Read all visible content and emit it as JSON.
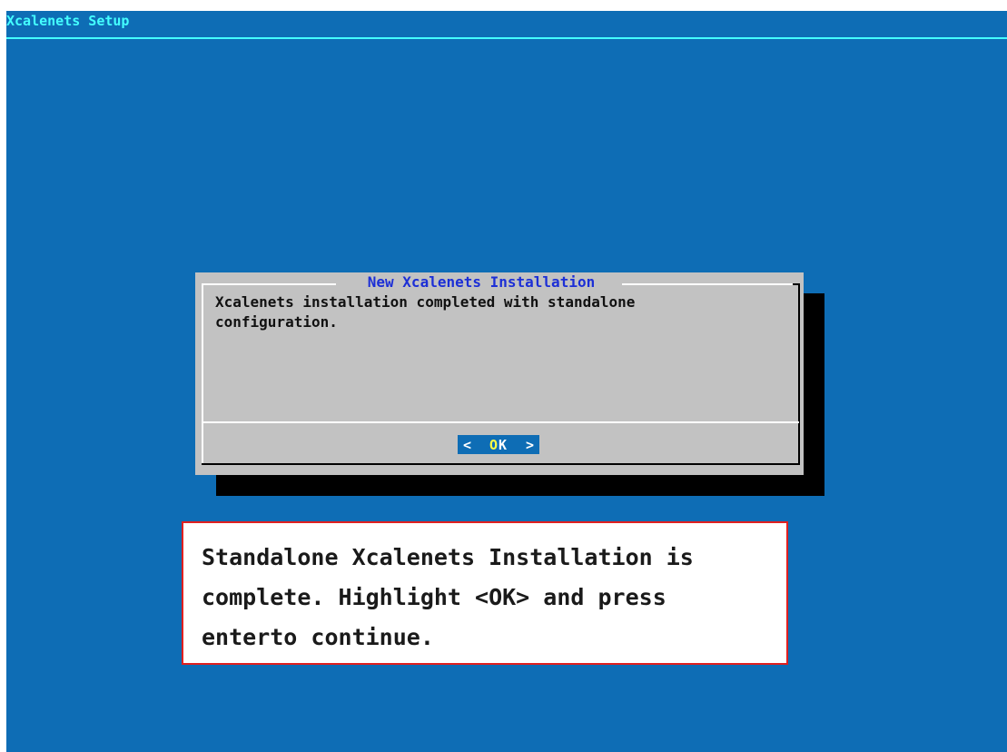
{
  "backtitle": "Xcalenets Setup",
  "dialog": {
    "title": "New Xcalenets Installation",
    "message": "Xcalenets installation completed with standalone\nconfiguration.",
    "ok_button": {
      "left": "<",
      "hotkey": "O",
      "rest": "K",
      "right": ">"
    }
  },
  "callout": {
    "text": "Standalone Xcalenets Installation is\ncomplete. Highlight <OK> and press\nenterto continue."
  },
  "colors": {
    "background": "#0e6db5",
    "backtitle": "#44ffff",
    "dialog": "#c2c2c2",
    "dialog_title": "#1c2fd6",
    "hotkey": "#ffff44",
    "callout_border": "#e02020"
  }
}
